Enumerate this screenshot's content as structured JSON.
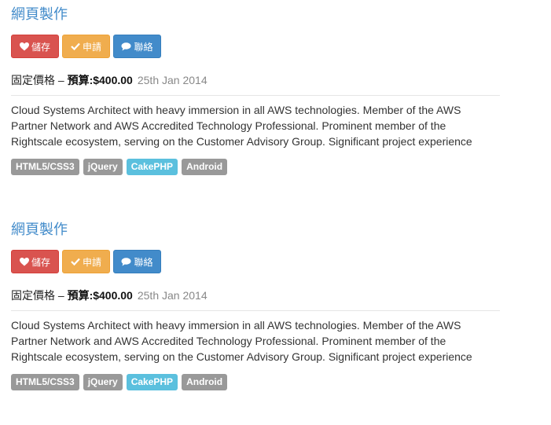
{
  "jobs": [
    {
      "title": "網頁製作",
      "buttons": {
        "save": "儲存",
        "apply": "申請",
        "contact": "聯絡"
      },
      "price_label": "固定價格 – ",
      "budget": "預算:$400.00",
      "date": "25th Jan 2014",
      "description": "Cloud Systems Architect with heavy immersion in all AWS technologies. Member of the AWS Partner Network and AWS Accredited Technology Professional. Prominent member of the Rightscale ecosystem, serving on the Customer Advisory Group. Significant project experience",
      "tags": [
        "HTML5/CSS3",
        "jQuery",
        "CakePHP",
        "Android"
      ]
    },
    {
      "title": "網頁製作",
      "buttons": {
        "save": "儲存",
        "apply": "申請",
        "contact": "聯絡"
      },
      "price_label": "固定價格 – ",
      "budget": "預算:$400.00",
      "date": "25th Jan 2014",
      "description": "Cloud Systems Architect with heavy immersion in all AWS technologies. Member of the AWS Partner Network and AWS Accredited Technology Professional. Prominent member of the Rightscale ecosystem, serving on the Customer Advisory Group. Significant project experience",
      "tags": [
        "HTML5/CSS3",
        "jQuery",
        "CakePHP",
        "Android"
      ]
    }
  ],
  "colors": {
    "title": "#428bca",
    "save": "#d9534f",
    "apply": "#f0ad4e",
    "contact": "#428bca",
    "tag_default": "#999999",
    "tag_info": "#5bc0de"
  },
  "icons": {
    "save": "heart-icon",
    "apply": "check-icon",
    "contact": "chat-bubble-icon"
  }
}
